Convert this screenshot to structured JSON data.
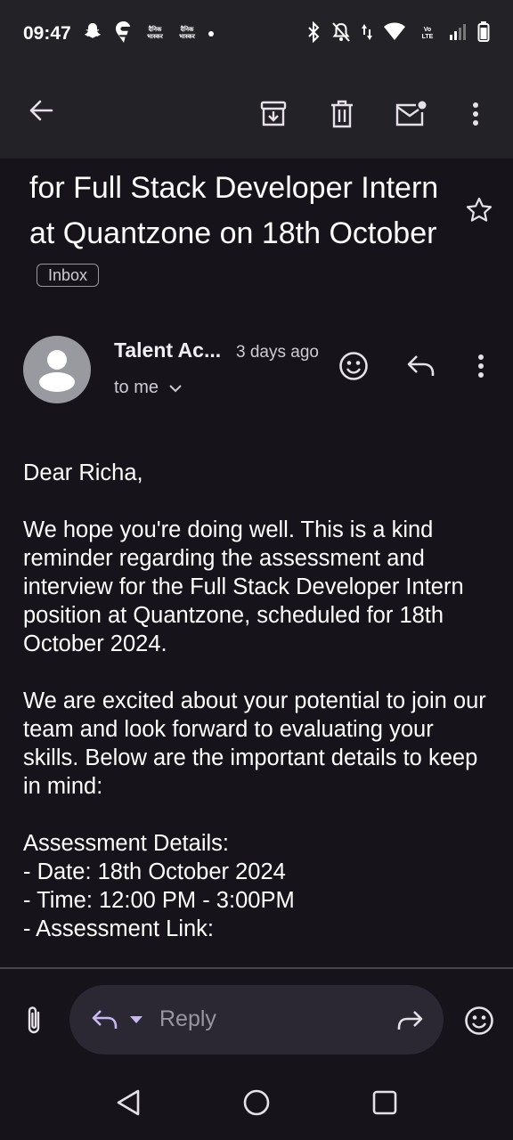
{
  "status_bar": {
    "time": "09:47",
    "left_icons": [
      "snapchat-icon",
      "swiggy-icon",
      "news-app-icon",
      "news-app-icon",
      "notification-dot-icon"
    ],
    "news_app_text": [
      "दैनिक",
      "भास्कर"
    ],
    "right_icons": [
      "bluetooth-icon",
      "do-not-disturb-icon",
      "data-arrows-icon",
      "wifi-icon",
      "volte-icon",
      "signal-icon",
      "battery-icon"
    ],
    "volte_text": [
      "Vo",
      "LTE"
    ]
  },
  "toolbar": {
    "icons": [
      "back-arrow-icon",
      "archive-icon",
      "delete-icon",
      "mark-unread-icon",
      "more-vert-icon"
    ]
  },
  "email": {
    "subject": "for Full Stack Developer Intern at Quantzone on 18th October",
    "label": "Inbox",
    "sender": "Talent Ac...",
    "time_ago": "3 days ago",
    "recipient": "to me",
    "body_paragraphs": [
      "Dear Richa,",
      "We hope you're doing well. This is a kind reminder regarding the assessment and interview for the Full Stack Developer Intern position at Quantzone, scheduled for 18th October 2024.",
      "We are excited about your potential to join our team and look forward to evaluating your skills. Below are the important details to keep in mind:"
    ],
    "details_lines": [
      "Assessment Details:",
      "- Date: 18th October 2024",
      "- Time: 12:00 PM - 3:00PM",
      "- Assessment Link:"
    ]
  },
  "reply_bar": {
    "placeholder": "Reply"
  },
  "colors": {
    "background": "#17131b",
    "app_bar": "#232227",
    "reply_pill": "#2b2733",
    "accent_reply": "#c9b8f2",
    "muted_text": "#cfcbd4"
  }
}
